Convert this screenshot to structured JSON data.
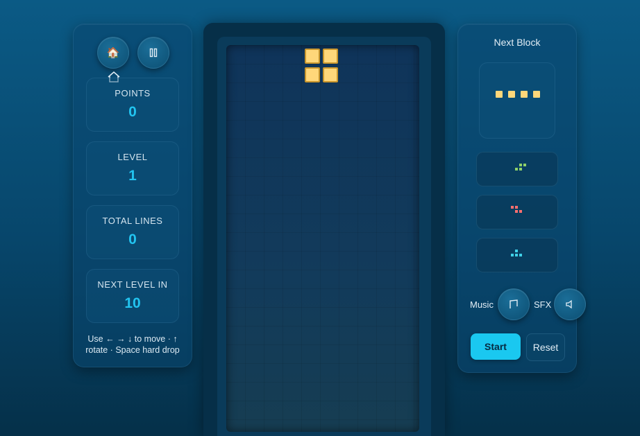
{
  "left": {
    "home_icon": "home-emoji-icon",
    "pause_icon": "pause-icon",
    "stats": [
      {
        "label": "POINTS",
        "value": "0"
      },
      {
        "label": "LEVEL",
        "value": "1"
      },
      {
        "label": "TOTAL LINES",
        "value": "0"
      },
      {
        "label": "NEXT LEVEL IN",
        "value": "10"
      }
    ],
    "help": "Use ← → ↓ to move · ↑ rotate · Space hard drop"
  },
  "board": {
    "active_piece": {
      "type": "O",
      "color": "#ffd77a"
    }
  },
  "right": {
    "next_title": "Next Block",
    "next_piece": {
      "type": "I",
      "color": "#ffd77a"
    },
    "queue": [
      {
        "type": "S",
        "color": "#8fd16a"
      },
      {
        "type": "Z",
        "color": "#ff6f6f"
      },
      {
        "type": "T",
        "color": "#3fd0e8"
      }
    ],
    "music_label": "Music",
    "sfx_label": "SFX",
    "start_label": "Start",
    "reset_label": "Reset"
  },
  "colors": {
    "accent": "#1ac8f0",
    "stat_value": "#22c4f0",
    "piece_yellow": "#ffd77a"
  }
}
